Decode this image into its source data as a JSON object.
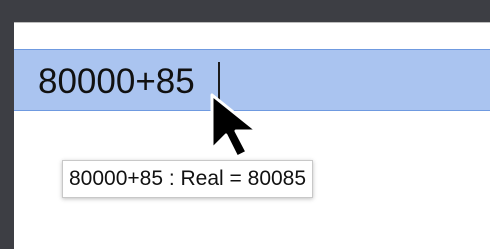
{
  "editor": {
    "expression": "80000+85"
  },
  "tooltip": {
    "text": "80000+85 : Real = 80085"
  },
  "colors": {
    "desktop_background": "#3d3e44",
    "selection_row": "#aac4f0",
    "selection_border": "#6f9ae0",
    "tooltip_background": "#ffffff"
  }
}
